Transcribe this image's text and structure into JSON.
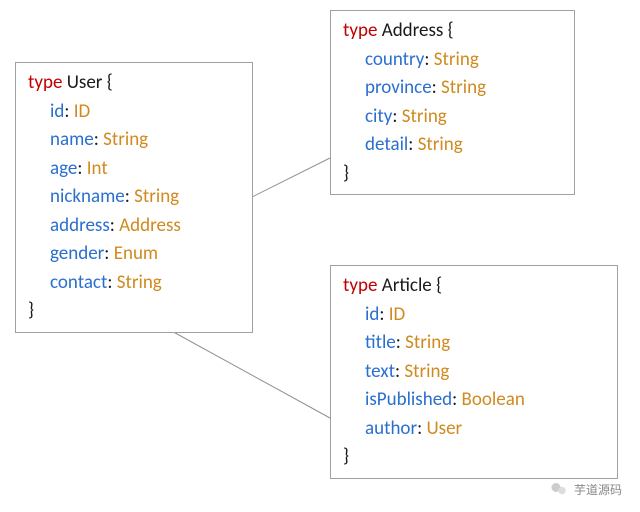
{
  "keyword": "type",
  "boxes": {
    "user": {
      "name": "User",
      "fields": [
        {
          "name": "id",
          "type": "ID"
        },
        {
          "name": "name",
          "type": "String"
        },
        {
          "name": "age",
          "type": "Int"
        },
        {
          "name": "nickname",
          "type": "String"
        },
        {
          "name": "address",
          "type": "Address"
        },
        {
          "name": "gender",
          "type": "Enum"
        },
        {
          "name": "contact",
          "type": "String"
        }
      ]
    },
    "address": {
      "name": "Address",
      "fields": [
        {
          "name": "country",
          "type": "String"
        },
        {
          "name": "province",
          "type": "String"
        },
        {
          "name": "city",
          "type": "String"
        },
        {
          "name": "detail",
          "type": "String"
        }
      ]
    },
    "article": {
      "name": "Article",
      "fields": [
        {
          "name": "id",
          "type": "ID"
        },
        {
          "name": "title",
          "type": "String"
        },
        {
          "name": "text",
          "type": "String"
        },
        {
          "name": "isPublished",
          "type": "Boolean"
        },
        {
          "name": "author",
          "type": "User"
        }
      ]
    }
  },
  "footer": "芋道源码"
}
